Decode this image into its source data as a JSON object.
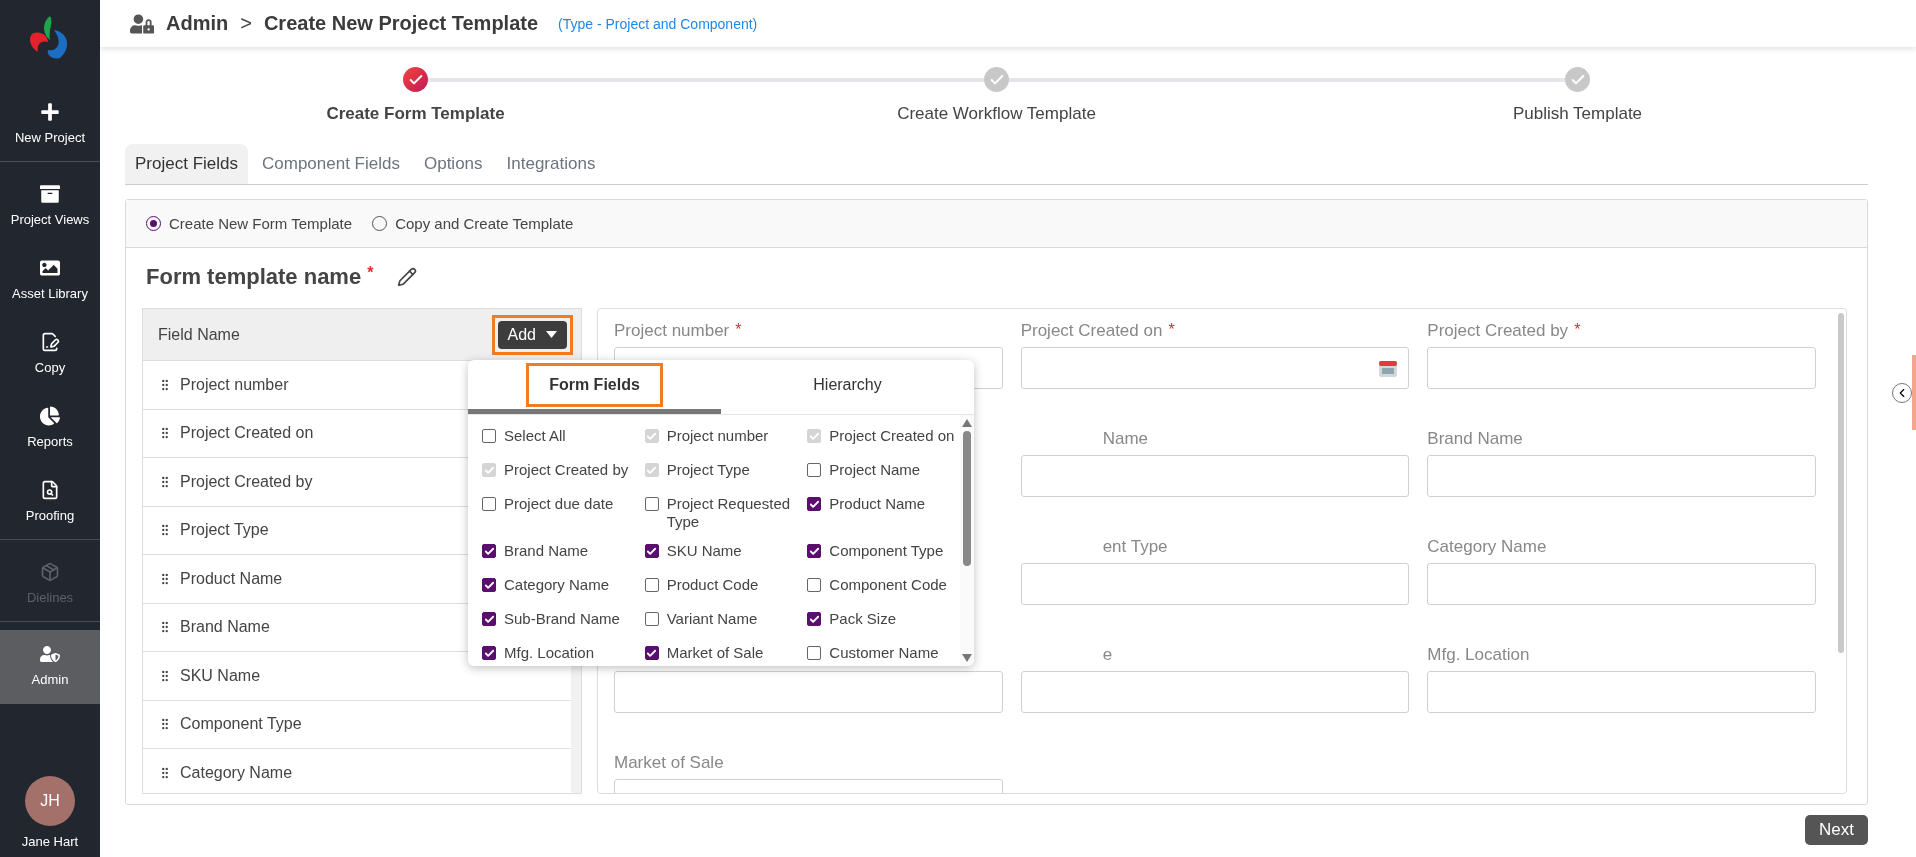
{
  "sidebar": {
    "items": [
      {
        "label": "New Project",
        "selected": false,
        "disabled": false,
        "divider_after": true
      },
      {
        "label": "Project Views",
        "selected": false,
        "disabled": false,
        "divider_after": false
      },
      {
        "label": "Asset Library",
        "selected": false,
        "disabled": false,
        "divider_after": false
      },
      {
        "label": "Copy",
        "selected": false,
        "disabled": false,
        "divider_after": false
      },
      {
        "label": "Reports",
        "selected": false,
        "disabled": false,
        "divider_after": false
      },
      {
        "label": "Proofing",
        "selected": false,
        "disabled": false,
        "divider_after": true
      },
      {
        "label": "Dielines",
        "selected": false,
        "disabled": true,
        "divider_after": true
      },
      {
        "label": "Admin",
        "selected": true,
        "disabled": false,
        "divider_after": false
      }
    ],
    "user": {
      "initials": "JH",
      "name": "Jane Hart"
    }
  },
  "header": {
    "crumbs": [
      "Admin",
      "Create New Project Template"
    ],
    "separator": ">",
    "subtitle": "(Type - Project and Component)"
  },
  "stepper": [
    {
      "label": "Create Form Template",
      "active": true
    },
    {
      "label": "Create Workflow Template",
      "active": false
    },
    {
      "label": "Publish Template",
      "active": false
    }
  ],
  "tabs": [
    {
      "label": "Project Fields",
      "selected": true
    },
    {
      "label": "Component Fields",
      "selected": false
    },
    {
      "label": "Options",
      "selected": false
    },
    {
      "label": "Integrations",
      "selected": false
    }
  ],
  "radios": [
    {
      "label": "Create New Form Template",
      "selected": true
    },
    {
      "label": "Copy and Create Template",
      "selected": false
    }
  ],
  "template_name": {
    "label": "Form template name",
    "required_mark": "*"
  },
  "field_list": {
    "header": "Field Name",
    "add_button": {
      "label": "Add",
      "highlighted": true
    },
    "rows": [
      "Project number",
      "Project Created on",
      "Project Created by",
      "Project Type",
      "Product Name",
      "Brand Name",
      "SKU Name",
      "Component Type",
      "Category Name"
    ]
  },
  "dropdown": {
    "tabs": [
      {
        "label": "Form Fields",
        "selected": true,
        "highlighted": true
      },
      {
        "label": "Hierarchy",
        "selected": false,
        "highlighted": false
      }
    ],
    "options": [
      {
        "label": "Select All",
        "checked": false,
        "disabled": false
      },
      {
        "label": "Project number",
        "checked": true,
        "disabled": true
      },
      {
        "label": "Project Created on",
        "checked": true,
        "disabled": true
      },
      {
        "label": "Project Created by",
        "checked": true,
        "disabled": true
      },
      {
        "label": "Project Type",
        "checked": true,
        "disabled": true
      },
      {
        "label": "Project Name",
        "checked": false,
        "disabled": false
      },
      {
        "label": "Project due date",
        "checked": false,
        "disabled": false
      },
      {
        "label": "Project Requested Type",
        "checked": false,
        "disabled": false
      },
      {
        "label": "Product Name",
        "checked": true,
        "disabled": false
      },
      {
        "label": "Brand Name",
        "checked": true,
        "disabled": false
      },
      {
        "label": "SKU Name",
        "checked": true,
        "disabled": false
      },
      {
        "label": "Component Type",
        "checked": true,
        "disabled": false
      },
      {
        "label": "Category Name",
        "checked": true,
        "disabled": false
      },
      {
        "label": "Product Code",
        "checked": false,
        "disabled": false
      },
      {
        "label": "Component Code",
        "checked": false,
        "disabled": false
      },
      {
        "label": "Sub-Brand Name",
        "checked": true,
        "disabled": false
      },
      {
        "label": "Variant Name",
        "checked": false,
        "disabled": false
      },
      {
        "label": "Pack Size",
        "checked": true,
        "disabled": false
      },
      {
        "label": "Mfg. Location",
        "checked": true,
        "disabled": false
      },
      {
        "label": "Market of Sale",
        "checked": true,
        "disabled": false
      },
      {
        "label": "Customer Name",
        "checked": false,
        "disabled": false
      }
    ]
  },
  "form": {
    "rows": [
      [
        {
          "label": "Project number",
          "required_mark": "*",
          "kind": "text"
        },
        {
          "label": "Project Created on",
          "required_mark": "*",
          "kind": "date"
        },
        {
          "label": "Project Created by",
          "required_mark": "*",
          "kind": "text"
        }
      ],
      [
        {
          "kind": "hidden"
        },
        {
          "label": "Name",
          "kind": "partial"
        },
        {
          "label": "Brand Name",
          "kind": "text"
        }
      ],
      [
        {
          "kind": "hidden"
        },
        {
          "label": "ent Type",
          "kind": "partial"
        },
        {
          "label": "Category Name",
          "kind": "text"
        }
      ],
      [
        {
          "kind": "hidden-label"
        },
        {
          "label": "e",
          "kind": "partial"
        },
        {
          "label": "Mfg. Location",
          "kind": "text"
        }
      ],
      [
        {
          "label": "Market of Sale",
          "kind": "text"
        }
      ]
    ]
  },
  "next_button": "Next"
}
